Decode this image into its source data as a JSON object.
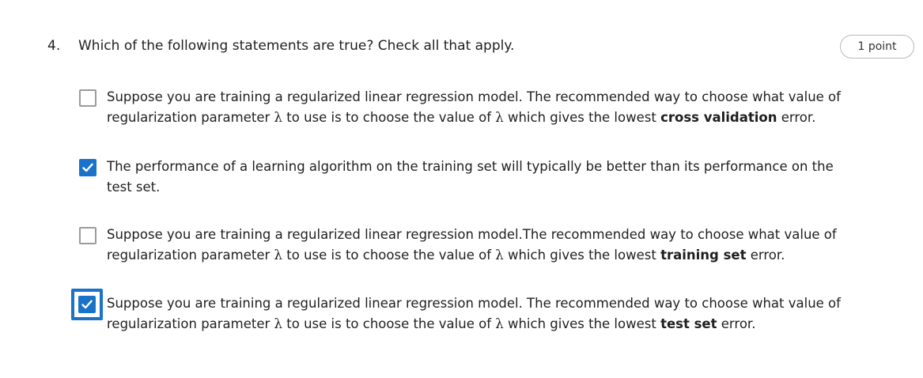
{
  "question": {
    "number": "4.",
    "prompt": "Which of the following statements are true? Check all that apply.",
    "points": "1 point"
  },
  "options": [
    {
      "checked": false,
      "focused": false,
      "line1": "Suppose you are training a regularized linear regression model. The recommended way to choose what value of",
      "line2_pre": "regularization parameter ",
      "lambda": "λ",
      "line2_mid": " to use is to choose the value of ",
      "line2_post": " which gives the lowest ",
      "emphasis": "cross validation",
      "line2_end": " error."
    },
    {
      "checked": true,
      "focused": false,
      "text": "The performance of a learning algorithm on the training set will typically be better than its performance on the test set."
    },
    {
      "checked": false,
      "focused": false,
      "line1": "Suppose you are training a regularized linear regression model.The recommended way to choose what value of",
      "line2_pre": "regularization parameter ",
      "lambda": "λ",
      "line2_mid": " to use is to choose the value of ",
      "line2_post": " which gives the lowest ",
      "emphasis": "training set",
      "line2_end": " error."
    },
    {
      "checked": true,
      "focused": true,
      "line1": "Suppose you are training a regularized linear regression model. The recommended way to choose what value of",
      "line2_pre": "regularization parameter ",
      "lambda": "λ",
      "line2_mid": " to use is to choose the value of ",
      "line2_post": " which gives the lowest ",
      "emphasis": "test set",
      "line2_end": " error."
    }
  ],
  "colors": {
    "accent": "#1a73c9",
    "checkbox_border": "#9b9b9b",
    "text": "#1f1f1f"
  },
  "icons": {
    "check": "checkmark-icon"
  }
}
